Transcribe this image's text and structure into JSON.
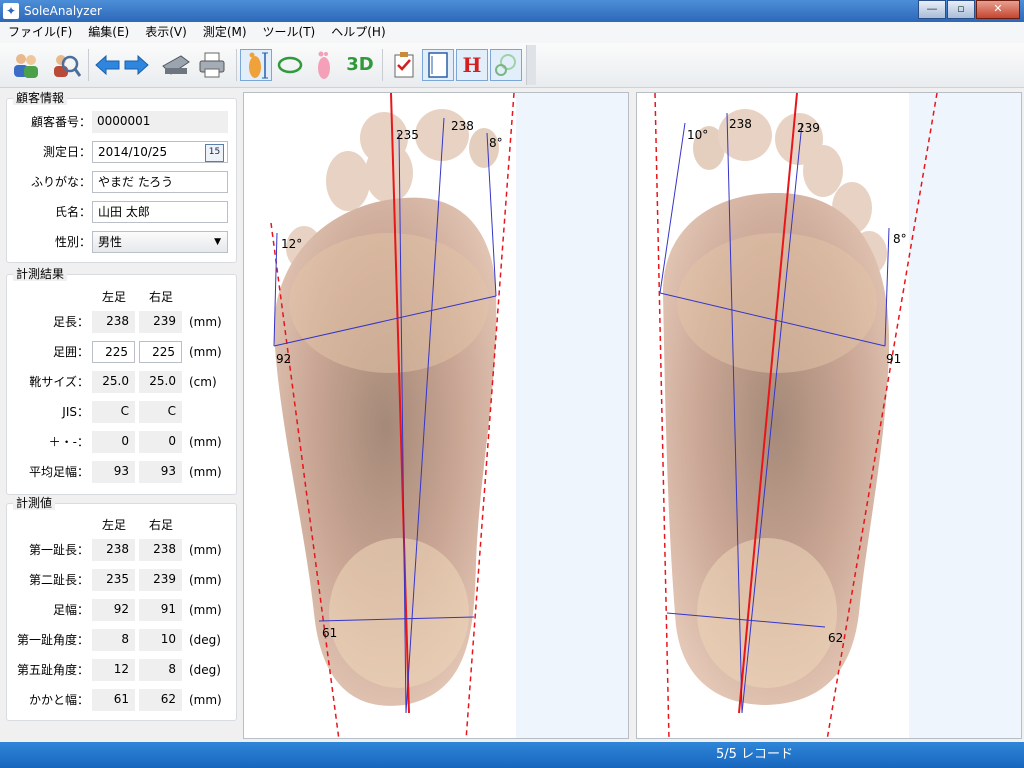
{
  "window": {
    "title": "SoleAnalyzer",
    "minimize": "—",
    "maximize": "▫",
    "close": "✕"
  },
  "menu": [
    "ファイル(F)",
    "編集(E)",
    "表示(V)",
    "測定(M)",
    "ツール(T)",
    "ヘルプ(H)"
  ],
  "toolbar": {
    "icons": [
      "customers-icon",
      "search-customer-icon",
      "back-arrow-icon",
      "forward-arrow-icon",
      "scanner-icon",
      "printer-icon",
      "foot-length-icon",
      "ellipse-icon",
      "foot-print-icon",
      "3d-view-icon",
      "checklist-icon",
      "measure-frame-icon",
      "heel-h-icon",
      "circle-tool-icon"
    ],
    "label_3d": "3D",
    "label_h": "H"
  },
  "customer": {
    "group_title": "顧客情報",
    "id_label": "顧客番号：",
    "id": "0000001",
    "date_label": "測定日：",
    "date": "2014/10/25",
    "calendar_day": "15",
    "kana_label": "ふりがな：",
    "kana": "やまだ たろう",
    "name_label": "氏名：",
    "name": "山田 太郎",
    "gender_label": "性別：",
    "gender": "男性"
  },
  "results": {
    "group_title": "計測結果",
    "left_hdr": "左足",
    "right_hdr": "右足",
    "rows": [
      {
        "label": "足長：",
        "left": "238",
        "right": "239",
        "unit": "(mm)"
      },
      {
        "label": "足囲：",
        "left": "225",
        "right": "225",
        "unit": "(mm)"
      },
      {
        "label": "靴サイズ：",
        "left": "25.0",
        "right": "25.0",
        "unit": "(cm)"
      },
      {
        "label": "JIS：",
        "left": "C",
        "right": "C",
        "unit": ""
      },
      {
        "label": "＋・-：",
        "left": "0",
        "right": "0",
        "unit": "(mm)"
      },
      {
        "label": "平均足幅：",
        "left": "93",
        "right": "93",
        "unit": "(mm)"
      }
    ]
  },
  "measurements": {
    "group_title": "計測値",
    "left_hdr": "左足",
    "right_hdr": "右足",
    "rows": [
      {
        "label": "第一趾長：",
        "left": "238",
        "right": "238",
        "unit": "(mm)"
      },
      {
        "label": "第二趾長：",
        "left": "235",
        "right": "239",
        "unit": "(mm)"
      },
      {
        "label": "足幅：",
        "left": "92",
        "right": "91",
        "unit": "(mm)"
      },
      {
        "label": "第一趾角度：",
        "left": "8",
        "right": "10",
        "unit": "(deg)"
      },
      {
        "label": "第五趾角度：",
        "left": "12",
        "right": "8",
        "unit": "(deg)"
      },
      {
        "label": "かかと幅：",
        "left": "61",
        "right": "62",
        "unit": "(mm)"
      }
    ]
  },
  "left_foot": {
    "second_toe": "235",
    "first_toe": "238",
    "hallux_angle": "8°",
    "fifth_angle": "12°",
    "width": "92",
    "heel": "61"
  },
  "right_foot": {
    "hallux_angle": "10°",
    "first_toe": "238",
    "second_toe": "239",
    "fifth_angle": "8°",
    "width": "91",
    "heel": "62"
  },
  "status": {
    "records": "5/5 レコード"
  },
  "colors": {
    "title": "#2c68b8",
    "status": "#1f74cc",
    "skin": "#d9b9a8",
    "red_line": "#e8161b",
    "blue_line": "#3535c8"
  }
}
